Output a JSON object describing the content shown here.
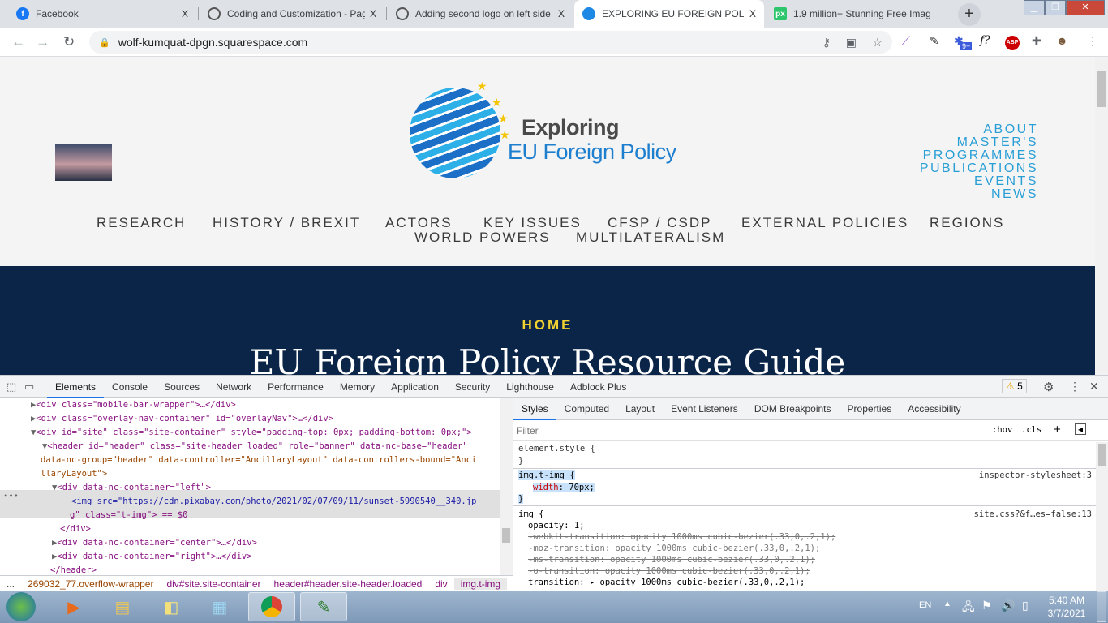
{
  "browser": {
    "tabs": [
      {
        "title": "Facebook",
        "icon": "facebook-icon",
        "color": "#1877f2"
      },
      {
        "title": "Coding and Customization - Pag",
        "icon": "squarespace-icon",
        "color": "#333333"
      },
      {
        "title": "Adding second logo on left side",
        "icon": "squarespace-icon",
        "color": "#333333"
      },
      {
        "title": "EXPLORING EU FOREIGN POLIC",
        "icon": "globe-icon",
        "color": "#1e88e5",
        "active": true
      },
      {
        "title": "1.9 million+ Stunning Free Imag",
        "icon": "pixabay-icon",
        "color": "#2ec66d"
      }
    ],
    "close_glyph": "X",
    "new_tab": "+",
    "url": "wolf-kumquat-dpgn.squarespace.com",
    "ext_badge": "9+",
    "ext_f": "f?",
    "abp": "ABP"
  },
  "site": {
    "logo_line1": "Exploring",
    "logo_line2": "EU Foreign Policy",
    "right_nav": [
      "ABOUT",
      "MASTER'S",
      "PROGRAMMES",
      "PUBLICATIONS",
      "EVENTS",
      "NEWS"
    ],
    "main_nav_row1": [
      "RESEARCH",
      "HISTORY / BREXIT",
      "ACTORS",
      "KEY ISSUES",
      "CFSP / CSDP",
      "EXTERNAL POLICIES",
      "REGIONS"
    ],
    "main_nav_row2": [
      "WORLD POWERS",
      "MULTILATERALISM"
    ],
    "hero_kicker": "HOME",
    "hero_title": "EU Foreign Policy Resource Guide",
    "colors": {
      "accent": "#2a9fd6",
      "hero_bg": "#0b2549",
      "kicker": "#f2d230"
    }
  },
  "devtools": {
    "tabs": [
      "Elements",
      "Console",
      "Sources",
      "Network",
      "Performance",
      "Memory",
      "Application",
      "Security",
      "Lighthouse",
      "Adblock Plus"
    ],
    "warnings": "5",
    "dom": [
      "<div class=\"mobile-bar-wrapper\">…</div>",
      "<div class=\"overlay-nav-container\" id=\"overlayNav\">…</div>",
      "<div id=\"site\" class=\"site-container\" style=\"padding-top: 0px; padding-bottom: 0px;\">",
      "<header id=\"header\" class=\"site-header loaded\" role=\"banner\" data-nc-base=\"header\"",
      "data-nc-group=\"header\" data-controller=\"AncillaryLayout\" data-controllers-bound=\"Anci",
      "llaryLayout\">",
      "<div data-nc-container=\"left\">",
      "<img src=\"https://cdn.pixabay.com/photo/2021/02/07/09/11/sunset-5990540__340.jp",
      "g\" class=\"t-img\"> == $0",
      "</div>",
      "<div data-nc-container=\"center\">…</div>",
      "<div data-nc-container=\"right\">…</div>",
      "</header>"
    ],
    "breadcrumbs": [
      "...",
      "269032_77.overflow-wrapper",
      "div#site.site-container",
      "header#header.site-header.loaded",
      "div",
      "img.t-img",
      "..."
    ],
    "style_tabs": [
      "Styles",
      "Computed",
      "Layout",
      "Event Listeners",
      "DOM Breakpoints",
      "Properties",
      "Accessibility"
    ],
    "filter_placeholder": "Filter",
    "hov": ":hov",
    "cls": ".cls",
    "rules": {
      "element_style": "element.style {",
      "close": "}",
      "r1_sel": "img.t-img {",
      "r1_src": "inspector-stylesheet:3",
      "r1_prop": "width",
      "r1_val": "70px;",
      "r2_sel": "img {",
      "r2_src": "site.css?&f…es=false:13",
      "r2_lines": [
        "opacity: 1;",
        "-webkit-transition: opacity 1000ms cubic-bezier(.33,0,.2,1);",
        "-moz-transition: opacity 1000ms cubic-bezier(.33,0,.2,1);",
        "-ms-transition: opacity 1000ms cubic-bezier(.33,0,.2,1);",
        "-o-transition: opacity 1000ms cubic-bezier(.33,0,.2,1);",
        "transition: ▸ opacity 1000ms cubic-bezier(.33,0,.2,1);"
      ]
    }
  },
  "taskbar": {
    "lang": "EN",
    "time": "5:40 AM",
    "date": "3/7/2021"
  }
}
